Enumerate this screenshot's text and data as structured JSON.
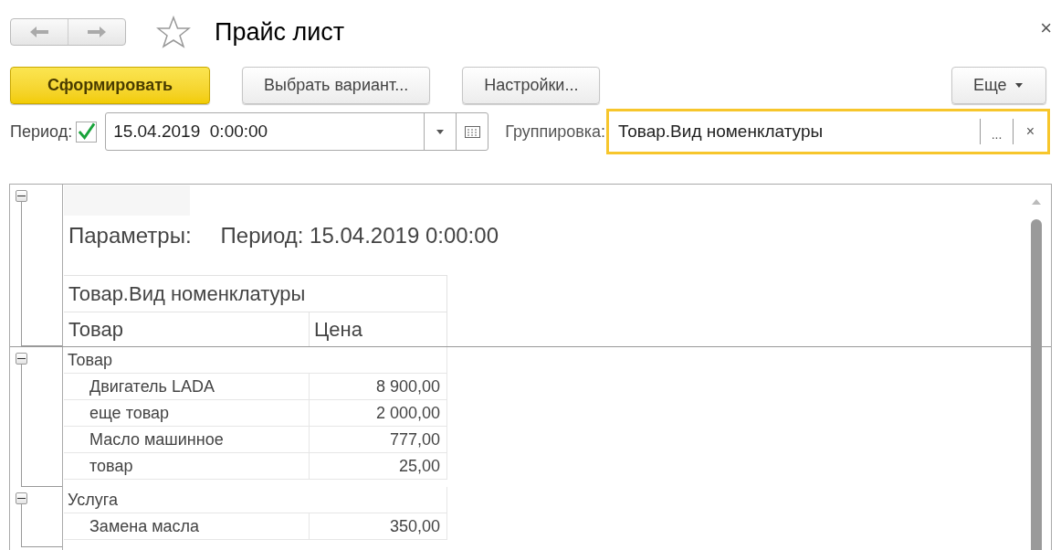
{
  "window": {
    "title": "Прайс лист",
    "close": "×"
  },
  "toolbar": {
    "buttons": [
      {
        "label": "Сформировать",
        "kind": "primary"
      },
      {
        "label": "Выбрать вариант...",
        "kind": "normal"
      },
      {
        "label": "Настройки...",
        "kind": "normal"
      }
    ],
    "more": "Еще"
  },
  "filters": {
    "period_label": "Период:",
    "period_enabled": true,
    "period_value": "15.04.2019  0:00:00",
    "grouping_label": "Группировка:",
    "grouping_value": "Товар.Вид номенклатуры",
    "grouping_button": "...",
    "grouping_clear": "×"
  },
  "report": {
    "expanded": true,
    "parameters_label": "Параметры:",
    "parameters_value": "Период: 15.04.2019 0:00:00",
    "group_header": "Товар.Вид номенклатуры",
    "columns": [
      "Товар",
      "Цена"
    ],
    "groups": [
      {
        "name": "Товар",
        "expanded": true,
        "rows": [
          {
            "item": "Двигатель LADA",
            "price": "8 900,00"
          },
          {
            "item": "еще товар",
            "price": "2 000,00"
          },
          {
            "item": "Масло машинное",
            "price": "777,00"
          },
          {
            "item": "товар",
            "price": "25,00"
          }
        ]
      },
      {
        "name": "Услуга",
        "expanded": true,
        "rows": [
          {
            "item": "Замена масла",
            "price": "350,00"
          }
        ]
      }
    ]
  }
}
